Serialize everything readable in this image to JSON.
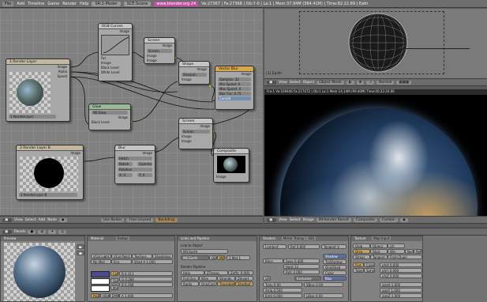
{
  "topbar": {
    "menu": [
      "File",
      "Add",
      "Timeline",
      "Game",
      "Render",
      "Help"
    ],
    "screen": "SR:2-Model",
    "scene": "SCE:Scone",
    "url": "www.blender.org 24",
    "stats": "Ve:27367 | Fa:27368 | Ob:7-0 | La:1 | Mem:37.94M (364.41M) | Time:82.22.89 | Eath"
  },
  "nodes": {
    "render_layer_1": {
      "title": "1 Render Layer",
      "out_image": "Image",
      "out_alpha": "Alpha",
      "out_speed": "Speed",
      "layer": "1 RenderLayer"
    },
    "rgb_curves": {
      "title": "RGB Curves",
      "out_image": "Image",
      "in_fac": "Fac",
      "in_image": "Image",
      "black": "Black Level",
      "white": "White Level"
    },
    "screen_1": {
      "title": "Screen",
      "out_image": "Image",
      "mode": "Screen",
      "val": "1",
      "in1": "Image",
      "in2": "Image"
    },
    "glow": {
      "title": "Glow",
      "field": "WI Glow",
      "out_image": "Image",
      "black": "Black Level",
      "white": "White Level"
    },
    "shape": {
      "title": "Shape",
      "out_image": "Image",
      "mode": "Sharpen",
      "in": "Image"
    },
    "vector_blur": {
      "title": "Vector Blur",
      "out_image": "Image",
      "samples": "Samples: 32",
      "min": "Min Speed: 0",
      "max": "Max Speed: 0",
      "fac": "Blur Fac: 0.75",
      "curved": "Curved",
      "in_image": "Image",
      "in_z": "Z",
      "in_speed": "Speed"
    },
    "screen_2": {
      "title": "Screen",
      "out_image": "Image",
      "mode": "Screen",
      "val": "1",
      "in1": "Image",
      "in2": "Image"
    },
    "render_layer_2": {
      "title": "2 Render Layer B",
      "out_image": "Image",
      "out_alpha": "Alpha",
      "layer": "2 RenderLayer B"
    },
    "blur": {
      "title": "Blur",
      "out_image": "Image",
      "type": "Hatch",
      "gauss": "Bokeh",
      "gamma": "Gamma",
      "relative": "Relative",
      "x": "X: 4",
      "y": "Y: 4",
      "in_image": "Image",
      "in_size": "Size"
    },
    "composite": {
      "title": "Composite",
      "in_image": "Image",
      "in_alpha": "Alpha",
      "in_z": "Z"
    }
  },
  "node_header": {
    "items": [
      "View",
      "Select",
      "Add",
      "Node"
    ],
    "use_nodes": "Use Nodes",
    "free_unused": "Free Unused",
    "backdrop": "Backdrop"
  },
  "view3d": {
    "label": "(1) Earth",
    "header": [
      "View",
      "Select",
      "Object"
    ],
    "mode": "Object Mode",
    "shading": "Normal"
  },
  "render_window": {
    "stats": "Fra:1  Ve:109446 Fa:217472 | Ob:1 La:1 Mem:14.14M (99.40M)  Time:00:22:20.00",
    "header": [
      "View",
      "Select",
      "Image"
    ],
    "image_name": "IM:Render Result",
    "pass": "Composite",
    "mode": "Combin"
  },
  "buttons": {
    "header": [
      "Panels"
    ],
    "preview": "Preview",
    "material": {
      "title": "Material",
      "tab2": "Ramps",
      "items": [
        "VCol Light",
        "VCol Paint",
        "TexFace",
        "Shadeless",
        "No Mist",
        "Env",
        "Shad A 1.000"
      ],
      "col": "Col",
      "spe": "Spe",
      "mir": "Mir",
      "r": "R 0.311",
      "g": "G 0.284",
      "b": "B 0.266",
      "rgb": "RGB",
      "hsv": "HSV",
      "dyn": "DYN",
      "a": "A 1.000"
    },
    "links": {
      "title": "Links and Pipeline",
      "tab2": "",
      "link_to": "Link to Object",
      "ma": "MA:Earth",
      "me": "ME:Earth",
      "ob": "OB",
      "me_btn": "ME",
      "mat": "1 Mat 1",
      "pipeline": "Render Pipeline",
      "halo": "Halo",
      "ztransp": "ZTransp",
      "zoffs": "Zoffs: 0.000",
      "fullosa": "Full Osa",
      "wire": "Wire",
      "strands": "Strands",
      "zinvert": "ZInvert",
      "radio": "Radio",
      "onlycast": "OnlyCast",
      "traceable": "Traceable",
      "shadbuf": "Shadbuf"
    },
    "shaders": {
      "title": "Shaders",
      "tab2": "Mirror Transp",
      "tab3": "SSS",
      "lambert": "Lambert",
      "ref": "Ref 0.800",
      "tangent": "Tangent V",
      "blinn": "Blinn",
      "spec": "Spec 0.400",
      "hard": "Hard 13",
      "refr": "Refr 4.000",
      "shadow": "Shadow",
      "traShadow": "TraShadow",
      "onlyshad": "OnlyShad",
      "cubic": "Cubic",
      "bias": "Bias",
      "exclusive": "Exclusive",
      "tralu": "Tralu 0.00",
      "sbias": "SBias 0.00",
      "amb": "Amb 0.500",
      "emit": "Emit 0.000",
      "lbias": "LBias 0.00",
      "gr": "GR:"
    },
    "texture": {
      "title": "Texture",
      "tab2": "Map Input",
      "items": [
        "Glob",
        "Object",
        "UV",
        "Orco",
        "Stick",
        "Win",
        "Nor",
        "Refl",
        "Stress",
        "Tangent",
        "From Dupli",
        "Flat",
        "Cube",
        "Tube",
        "Sphe"
      ],
      "ofs": [
        "ofsX 0.000",
        "ofsY 0.000",
        "ofsZ 0.000"
      ],
      "size": [
        "sizeX 1.000",
        "sizeY 1.000",
        "sizeZ 1.000"
      ]
    }
  }
}
